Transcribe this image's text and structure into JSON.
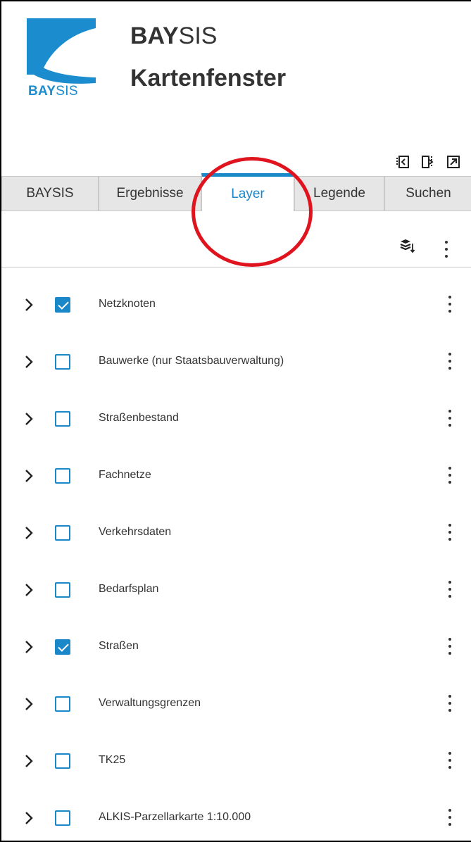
{
  "header": {
    "logo_text_bold": "BAY",
    "logo_text_thin": "SIS",
    "title_bold": "BAY",
    "title_thin": "SIS",
    "subtitle": "Kartenfenster"
  },
  "window_controls": [
    {
      "icon": "collapse-panel-icon"
    },
    {
      "icon": "split-panel-icon"
    },
    {
      "icon": "open-external-icon"
    }
  ],
  "tabs": [
    {
      "label": "BAYSIS",
      "active": false
    },
    {
      "label": "Ergebnisse",
      "active": false
    },
    {
      "label": "Layer",
      "active": true
    },
    {
      "label": "Legende",
      "active": false
    },
    {
      "label": "Suchen",
      "active": false
    }
  ],
  "toolbar": {
    "layers_icon": "layer-stack-sort-icon",
    "menu_icon": "kebab-menu-icon"
  },
  "layers": [
    {
      "label": "Netzknoten",
      "checked": true
    },
    {
      "label": "Bauwerke (nur Staatsbauverwaltung)",
      "checked": false
    },
    {
      "label": "Straßenbestand",
      "checked": false
    },
    {
      "label": "Fachnetze",
      "checked": false
    },
    {
      "label": "Verkehrsdaten",
      "checked": false
    },
    {
      "label": "Bedarfsplan",
      "checked": false
    },
    {
      "label": "Straßen",
      "checked": true
    },
    {
      "label": "Verwaltungsgrenzen",
      "checked": false
    },
    {
      "label": "TK25",
      "checked": false
    },
    {
      "label": "ALKIS-Parzellarkarte 1:10.000",
      "checked": false
    }
  ],
  "colors": {
    "accent": "#1a87c9",
    "annotation": "#e0141e",
    "tab_inactive_bg": "#e6e6e6"
  }
}
